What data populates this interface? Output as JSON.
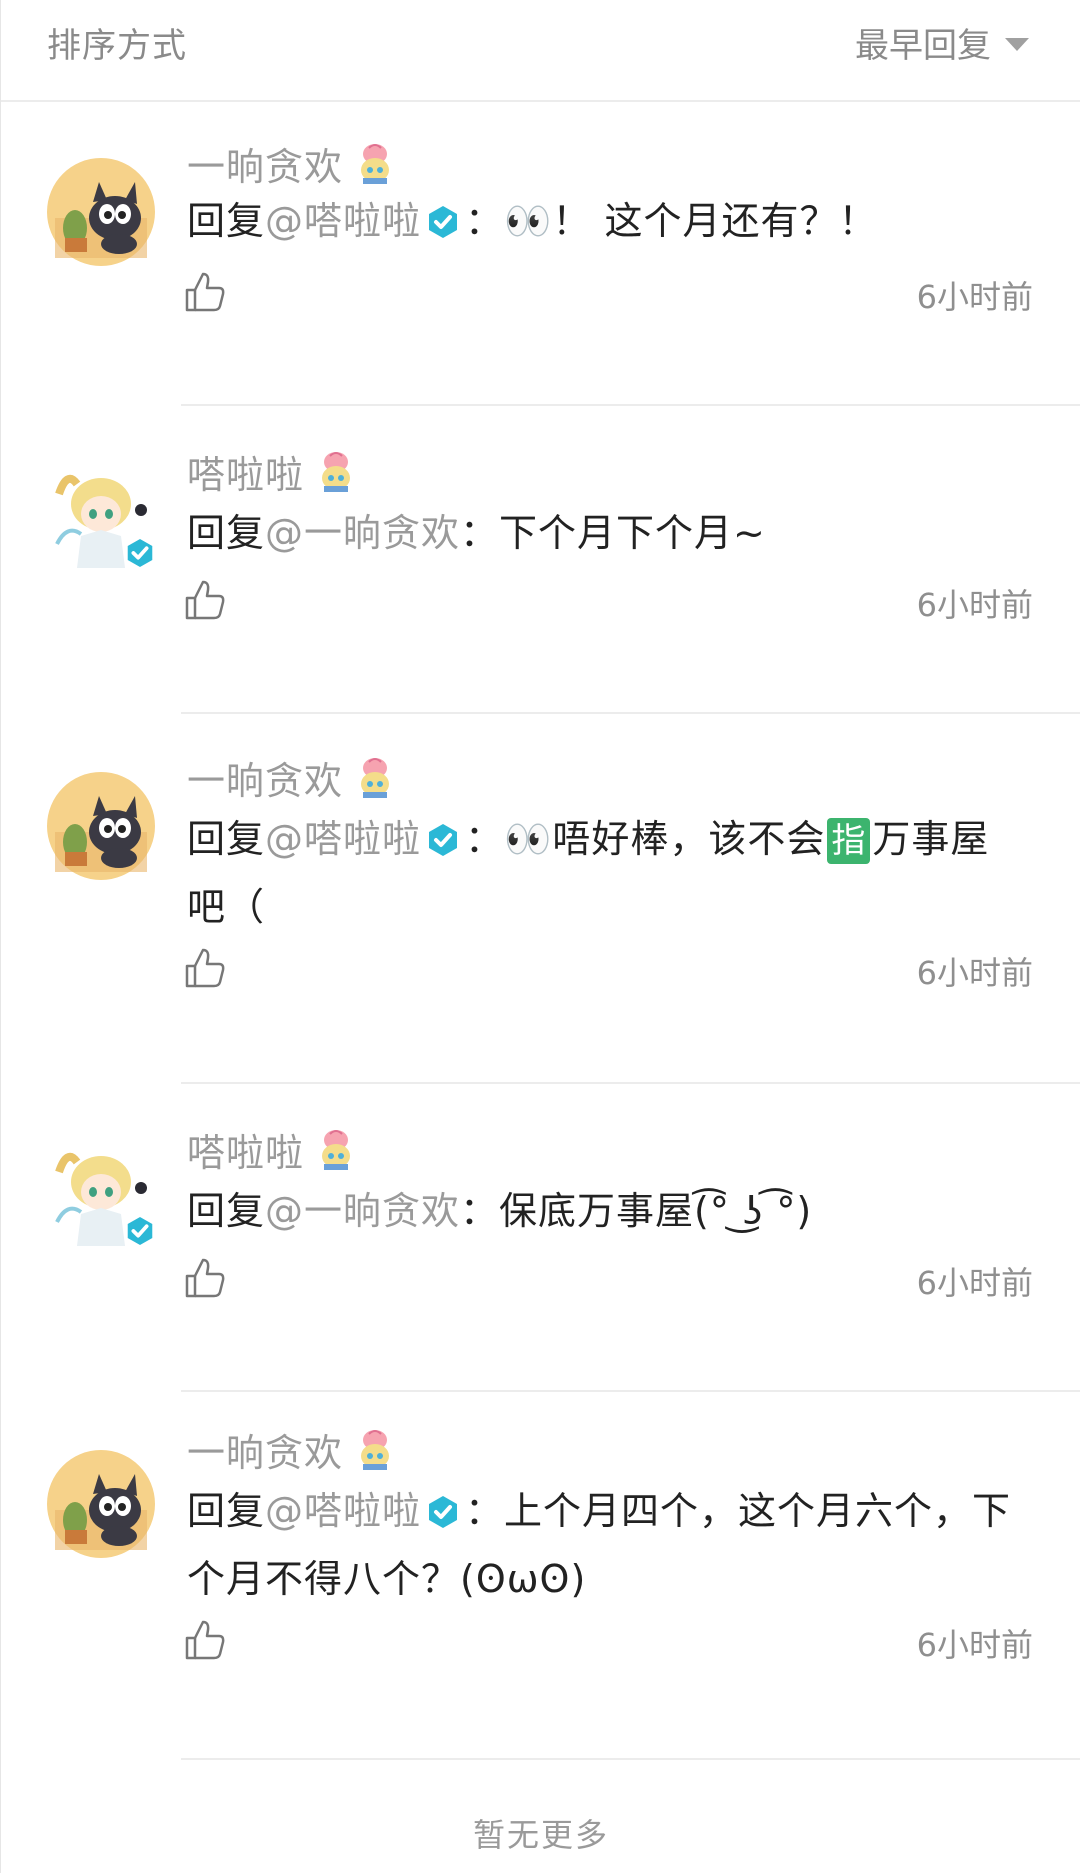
{
  "sort": {
    "label": "排序方式",
    "value": "最早回复"
  },
  "comments": [
    {
      "username": "一晌贪欢",
      "reply_prefix": "回复",
      "mention": "@嗒啦啦",
      "colon": "：",
      "body": "👀！ 这个月还有？！",
      "time": "6小时前"
    },
    {
      "username": "嗒啦啦",
      "reply_prefix": "回复",
      "mention": "@一晌贪欢",
      "colon": "：",
      "body": "下个月下个月~",
      "time": "6小时前"
    },
    {
      "username": "一晌贪欢",
      "reply_prefix": "回复",
      "mention": "@嗒啦啦",
      "colon": "：",
      "body_before": "👀唔好棒，该不会",
      "tag": "指",
      "body_after": "万事屋吧（",
      "time": "6小时前"
    },
    {
      "username": "嗒啦啦",
      "reply_prefix": "回复",
      "mention": "@一晌贪欢",
      "colon": "：",
      "body": "保底万事屋(͡° ͜ʖ ͡°)",
      "time": "6小时前"
    },
    {
      "username": "一晌贪欢",
      "reply_prefix": "回复",
      "mention": "@嗒啦啦",
      "colon": "：",
      "body": "上个月四个，这个月六个，下个月不得八个？(ʘωʘ)",
      "time": "6小时前"
    }
  ],
  "footer": "暂无更多",
  "colors": {
    "verified": "#2bb8d6",
    "tag": "#3cb46e",
    "muted": "#9a9a9a"
  },
  "icons": {
    "like": "thumbs-up-icon",
    "verified": "verified-check-icon",
    "sort_caret": "caret-down-icon",
    "user_badge": "peach-character-icon"
  }
}
